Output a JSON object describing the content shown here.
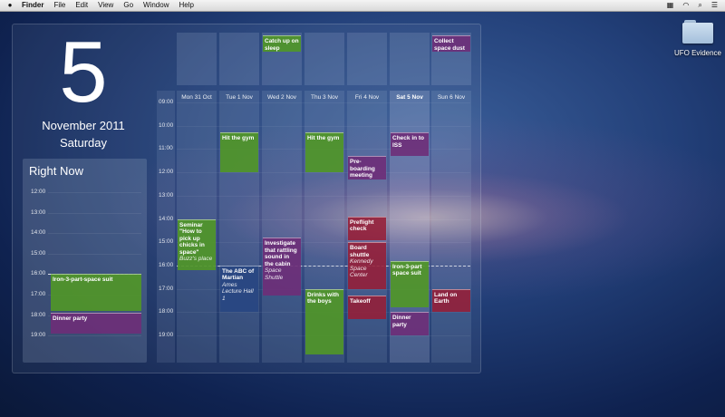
{
  "menubar": {
    "apple": "",
    "items": [
      "Finder",
      "File",
      "Edit",
      "View",
      "Go",
      "Window",
      "Help"
    ],
    "right_icons": [
      "grid-icon",
      "wifi-icon",
      "spotlight-icon",
      "list-icon"
    ]
  },
  "desktop_icon": {
    "label": "UFO Evidence",
    "icon": "folder-icon"
  },
  "date": {
    "day": "5",
    "month_year": "November 2011",
    "weekday": "Saturday"
  },
  "right_now": {
    "title": "Right Now",
    "hours": [
      "12:00",
      "13:00",
      "14:00",
      "15:00",
      "16:00",
      "17:00",
      "18:00",
      "19:00"
    ],
    "events": [
      {
        "title": "Iron-3-part-space suit",
        "color": "green"
      },
      {
        "title": "Dinner party",
        "color": "purple"
      }
    ]
  },
  "days": [
    {
      "label": "Mon 31 Oct"
    },
    {
      "label": "Tue 1 Nov"
    },
    {
      "label": "Wed 2 Nov"
    },
    {
      "label": "Thu 3 Nov"
    },
    {
      "label": "Fri 4 Nov"
    },
    {
      "label": "Sat 5 Nov"
    },
    {
      "label": "Sun 6 Nov"
    }
  ],
  "hours": [
    "09:00",
    "10:00",
    "11:00",
    "12:00",
    "13:00",
    "14:00",
    "15:00",
    "16:00",
    "17:00",
    "18:00",
    "19:00"
  ],
  "allday_events": [
    {
      "title": "Catch up on sleep",
      "day": 2,
      "color": "green"
    },
    {
      "title": "Collect space dust",
      "day": 6,
      "color": "purple"
    }
  ],
  "events": [
    {
      "title": "Seminar \"How to pick up chicks in space\"",
      "location": "Buzz's place",
      "day": 0,
      "start": 14.0,
      "end": 16.2,
      "color": "green"
    },
    {
      "title": "Hit the gym",
      "location": "",
      "day": 1,
      "start": 10.3,
      "end": 12.0,
      "color": "green"
    },
    {
      "title": "The ABC of Martian",
      "location": "Ames Lecture Hall 1",
      "day": 1,
      "start": 16.0,
      "end": 18.0,
      "color": "blue"
    },
    {
      "title": "Investigate that rattling sound in the cabin",
      "location": "Space Shuttle",
      "day": 2,
      "start": 14.8,
      "end": 17.3,
      "color": "purple"
    },
    {
      "title": "Hit the gym",
      "location": "",
      "day": 3,
      "start": 10.3,
      "end": 12.0,
      "color": "green"
    },
    {
      "title": "Drinks with the boys",
      "location": "",
      "day": 3,
      "start": 17.0,
      "end": 19.8,
      "color": "green"
    },
    {
      "title": "Pre-boarding meeting",
      "location": "",
      "day": 4,
      "start": 11.3,
      "end": 12.3,
      "color": "purple"
    },
    {
      "title": "Preflight check",
      "location": "",
      "day": 4,
      "start": 13.9,
      "end": 14.9,
      "color": "red"
    },
    {
      "title": "Board shuttle",
      "location": "Kennedy Space Center",
      "day": 4,
      "start": 15.0,
      "end": 17.0,
      "color": "red"
    },
    {
      "title": "Takeoff",
      "location": "",
      "day": 4,
      "start": 17.3,
      "end": 18.3,
      "color": "red"
    },
    {
      "title": "Check in to ISS",
      "location": "",
      "day": 5,
      "start": 10.3,
      "end": 11.3,
      "color": "purple"
    },
    {
      "title": "Iron-3-part space suit",
      "location": "",
      "day": 5,
      "start": 15.8,
      "end": 17.8,
      "color": "green"
    },
    {
      "title": "Dinner party",
      "location": "",
      "day": 5,
      "start": 18.0,
      "end": 19.0,
      "color": "purple"
    },
    {
      "title": "Land on Earth",
      "location": "",
      "day": 6,
      "start": 17.0,
      "end": 18.0,
      "color": "red"
    }
  ]
}
